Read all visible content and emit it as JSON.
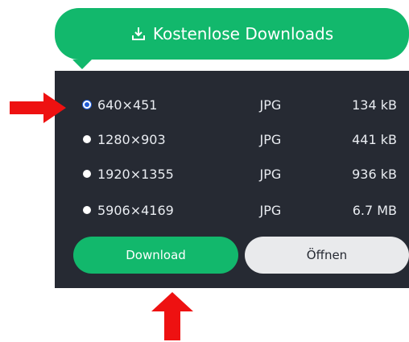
{
  "top_button": {
    "label": "Kostenlose Downloads",
    "icon": "download-tray-icon",
    "color": "#12b86c"
  },
  "options": [
    {
      "resolution": "640×451",
      "format": "JPG",
      "size": "134 kB",
      "selected": true
    },
    {
      "resolution": "1280×903",
      "format": "JPG",
      "size": "441 kB",
      "selected": false
    },
    {
      "resolution": "1920×1355",
      "format": "JPG",
      "size": "936 kB",
      "selected": false
    },
    {
      "resolution": "5906×4169",
      "format": "JPG",
      "size": "6.7 MB",
      "selected": false
    }
  ],
  "actions": {
    "download_label": "Download",
    "open_label": "Öffnen"
  },
  "colors": {
    "panel": "#262a33",
    "accent": "#12b86c",
    "selected_radio": "#1f5bd6",
    "annotation_arrow": "#ee1111"
  }
}
